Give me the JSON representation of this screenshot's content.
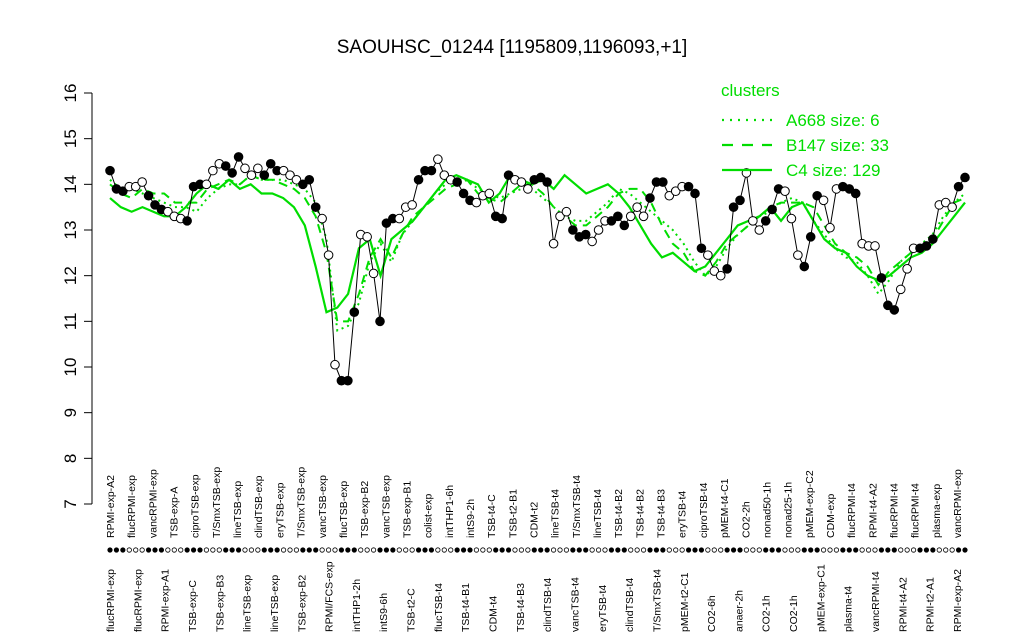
{
  "chart_data": {
    "type": "line",
    "title": "SAOUHSC_01244 [1195809,1196093,+1]",
    "xlabel": "",
    "ylabel": "",
    "ylim": [
      7,
      16
    ],
    "yticks": [
      7,
      8,
      9,
      10,
      11,
      12,
      13,
      14,
      15,
      16
    ],
    "grid": false,
    "legend": {
      "title": "clusters",
      "placement": "top-right",
      "entries": [
        {
          "label": "A668 size: 6",
          "style": "dotted"
        },
        {
          "label": "B147 size: 33",
          "style": "dashed"
        },
        {
          "label": "C4 size: 129",
          "style": "solid"
        }
      ]
    },
    "colors": {
      "cluster_line": "#00dd00",
      "data_line": "#000000",
      "axis": "#000000"
    },
    "top_labels": [
      "RPMI-exp-A2",
      "flucRPMI-exp",
      "vancRPMI-exp",
      "TSB-exp-A",
      "ciproTSB-exp",
      "T/SmxTSB-exp",
      "lineTSB-exp",
      "clindTSB-exp",
      "eryTSB-exp",
      "T/SmxTSB-exp",
      "vancTSB-exp",
      "flucTSB-exp",
      "TSB-exp-B2",
      "vancTSB-exp",
      "TSB-exp-B1",
      "colist-exp",
      "intTHP1-6h",
      "intS9-2h",
      "TSB-t4-C",
      "TSB-t2-B1",
      "CDM-t2",
      "lineTSB-t4",
      "T/SmxTSB-t4",
      "lineTSB-t4",
      "TSB-t4-B2",
      "TSB-t4-B2",
      "TSB-t4-B3",
      "eryTSB-t4",
      "ciproTSB-t4",
      "pMEM-t4-C1",
      "CO2-2h",
      "nonad50-1h",
      "nonad25-1h",
      "pMEM-exp-C2",
      "CDM-exp",
      "flucRPMI-t4",
      "RPMI-t4-A2",
      "flucRPMI-t4",
      "flucRPMI-t4",
      "plasma-exp",
      "vancRPMI-exp"
    ],
    "bottom_labels": [
      "flucRPMI-exp",
      "flucRPMI-exp",
      "RPMI-exp-A1",
      "TSB-exp-C",
      "TSB-exp-B3",
      "lineTSB-exp",
      "lineTSB-exp",
      "TSB-exp-B2",
      "RPMI/FCS-exp",
      "intTHP1-2h",
      "intS9-6h",
      "TSB-t2-C",
      "flucTSB-t4",
      "TSB-t4-B1",
      "CDM-t4",
      "TSB-t4-B3",
      "clindTSB-t4",
      "vancTSB-t4",
      "eryTSB-t4",
      "clindTSB-t4",
      "T/SmxTSB-t4",
      "pMEM-t2-C1",
      "CO2-6h",
      "anaer-2h",
      "CO2-1h",
      "CO2-1h",
      "pMEM-exp-C1",
      "plasma-t4",
      "vancRPMI-t4",
      "RPMI-t4-A2",
      "RPMI-t2-A1",
      "RPMI-exp-A2"
    ],
    "series": [
      {
        "name": "",
        "kind": "data",
        "y": [
          14.3,
          13.9,
          13.85,
          13.95,
          13.95,
          14.05,
          13.75,
          13.55,
          13.45,
          13.4,
          13.3,
          13.25,
          13.2,
          13.95,
          14.0,
          14.0,
          14.3,
          14.45,
          14.4,
          14.25,
          14.6,
          14.35,
          14.2,
          14.35,
          14.2,
          14.45,
          14.3,
          14.3,
          14.2,
          14.1,
          14.0,
          14.1,
          13.5,
          13.25,
          12.45,
          10.05,
          9.7,
          9.7,
          11.2,
          12.9,
          12.85,
          12.05,
          11.0,
          13.15,
          13.25,
          13.25,
          13.5,
          13.55,
          14.1,
          14.3,
          14.3,
          14.55,
          14.2,
          14.1,
          14.05,
          13.8,
          13.65,
          13.6,
          13.75,
          13.8,
          13.3,
          13.25,
          14.2,
          14.1,
          14.05,
          13.9,
          14.1,
          14.15,
          14.05,
          12.7,
          13.3,
          13.4,
          13.0,
          12.85,
          12.9,
          12.75,
          13.0,
          13.2,
          13.2,
          13.3,
          13.1,
          13.3,
          13.5,
          13.3,
          13.7,
          14.05,
          14.05,
          13.75,
          13.85,
          13.95,
          13.95,
          13.8,
          12.6,
          12.45,
          12.1,
          12.0,
          12.15,
          13.5,
          13.65,
          14.25,
          13.2,
          13.0,
          13.2,
          13.45,
          13.9,
          13.85,
          13.25,
          12.45,
          12.2,
          12.85,
          13.75,
          13.65,
          13.05,
          13.9,
          13.95,
          13.9,
          13.8,
          12.7,
          12.65,
          12.65,
          11.95,
          11.35,
          11.25,
          11.7,
          12.15,
          12.6,
          12.6,
          12.65,
          12.8,
          13.55,
          13.6,
          13.5,
          13.95,
          14.15
        ]
      },
      {
        "name": "A668 size: 6",
        "kind": "dotted",
        "y": [
          14.1,
          13.9,
          13.9,
          13.8,
          13.7,
          13.6,
          13.5,
          13.5,
          13.4,
          13.7,
          13.9,
          14.0,
          14.0,
          14.2,
          14.1,
          14.1,
          14.1,
          14.0,
          13.9,
          13.6,
          12.8,
          10.8,
          10.9,
          11.4,
          12.3,
          12.7,
          12.3,
          12.9,
          13.2,
          13.5,
          13.8,
          14.0,
          14.1,
          14.1,
          13.9,
          13.8,
          13.7,
          13.8,
          13.9,
          13.9,
          13.7,
          13.5,
          13.3,
          13.2,
          13.2,
          13.4,
          13.6,
          13.9,
          13.8,
          13.6,
          13.4,
          13.2,
          13.0,
          12.7,
          12.3,
          12.0,
          12.2,
          12.6,
          12.9,
          13.1,
          13.3,
          13.4,
          13.6,
          13.7,
          13.6,
          13.2,
          12.9,
          12.6,
          12.4,
          12.3,
          12.0,
          11.6,
          11.9,
          12.3,
          12.5,
          12.7,
          12.9,
          13.3,
          13.6,
          13.8
        ]
      },
      {
        "name": "B147 size: 33",
        "kind": "dashed",
        "y": [
          14.0,
          13.8,
          13.7,
          13.9,
          13.8,
          13.8,
          13.6,
          13.6,
          13.6,
          13.9,
          14.0,
          14.1,
          14.0,
          14.2,
          14.1,
          14.1,
          14.0,
          13.9,
          13.7,
          13.3,
          12.5,
          11.0,
          11.0,
          11.6,
          12.4,
          12.8,
          12.4,
          12.9,
          13.3,
          13.5,
          13.7,
          13.9,
          14.0,
          14.1,
          13.8,
          13.7,
          13.6,
          13.8,
          14.0,
          14.0,
          13.8,
          13.5,
          13.3,
          13.1,
          13.1,
          13.3,
          13.5,
          13.8,
          13.9,
          13.9,
          13.6,
          13.1,
          12.7,
          12.5,
          12.1,
          12.0,
          12.3,
          12.7,
          12.9,
          13.1,
          13.3,
          13.5,
          13.6,
          13.6,
          13.6,
          13.5,
          13.1,
          12.7,
          12.5,
          12.4,
          12.2,
          11.8,
          12.1,
          12.3,
          12.5,
          12.6,
          12.8,
          13.2,
          13.6,
          13.7
        ]
      },
      {
        "name": "C4 size: 129",
        "kind": "solid",
        "y": [
          13.7,
          13.5,
          13.4,
          13.5,
          13.4,
          13.3,
          13.3,
          13.5,
          13.8,
          14.0,
          13.9,
          14.1,
          13.9,
          14.0,
          13.8,
          13.8,
          13.7,
          13.5,
          13.1,
          12.2,
          11.2,
          11.3,
          11.6,
          12.6,
          12.8,
          12.0,
          12.8,
          13.0,
          13.2,
          13.5,
          13.8,
          14.1,
          14.2,
          14.1,
          14.0,
          13.6,
          13.8,
          14.2,
          14.1,
          14.0,
          14.1,
          13.9,
          14.2,
          14.0,
          13.8,
          13.9,
          14.0,
          13.8,
          13.5,
          13.1,
          12.7,
          12.4,
          12.5,
          12.3,
          12.1,
          12.2,
          12.5,
          12.8,
          13.1,
          13.2,
          13.3,
          13.5,
          13.2,
          13.5,
          13.6,
          13.2,
          12.8,
          12.6,
          12.5,
          12.2,
          12.0,
          11.9,
          12.0,
          12.2,
          12.4,
          12.5,
          12.7,
          13.0,
          13.3,
          13.6
        ]
      }
    ]
  }
}
